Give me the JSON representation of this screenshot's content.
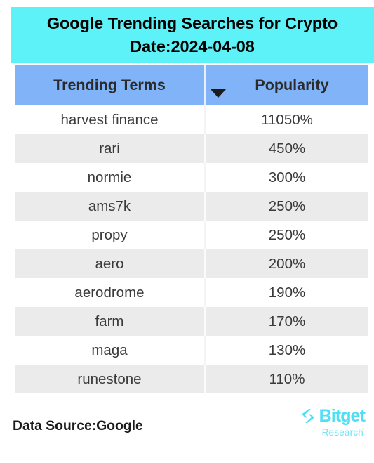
{
  "title": {
    "line1": "Google Trending Searches for Crypto",
    "line2": "Date:2024-04-08",
    "background_color": "#5cf2f7",
    "text_color": "#000000"
  },
  "table": {
    "header_background_color": "#80b3f8",
    "row_alt_background_color": "#ebebeb",
    "columns": [
      {
        "key": "term",
        "label": "Trending Terms",
        "sort_indicator": ""
      },
      {
        "key": "popularity",
        "label": "Popularity",
        "sort_indicator": "chevron-down-icon"
      }
    ],
    "rows": [
      {
        "term": "harvest finance",
        "popularity": "11050%"
      },
      {
        "term": "rari",
        "popularity": "450%"
      },
      {
        "term": "normie",
        "popularity": "300%"
      },
      {
        "term": "ams7k",
        "popularity": "250%"
      },
      {
        "term": "propy",
        "popularity": "250%"
      },
      {
        "term": "aero",
        "popularity": "200%"
      },
      {
        "term": "aerodrome",
        "popularity": "190%"
      },
      {
        "term": "farm",
        "popularity": "170%"
      },
      {
        "term": "maga",
        "popularity": "130%"
      },
      {
        "term": "runestone",
        "popularity": "110%"
      }
    ]
  },
  "footer": {
    "data_source": "Data Source:Google",
    "brand_name": "Bitget",
    "brand_subtitle": "Research",
    "brand_color": "#4ddff5"
  },
  "chart_data": {
    "type": "table",
    "title": "Google Trending Searches for Crypto Date:2024-04-08",
    "columns": [
      "Trending Terms",
      "Popularity"
    ],
    "categories": [
      "harvest finance",
      "rari",
      "normie",
      "ams7k",
      "propy",
      "aero",
      "aerodrome",
      "farm",
      "maga",
      "runestone"
    ],
    "values": [
      11050,
      450,
      300,
      250,
      250,
      200,
      190,
      170,
      130,
      110
    ],
    "value_unit": "%",
    "sorted_by": "Popularity",
    "sort_order": "descending",
    "source": "Google"
  }
}
